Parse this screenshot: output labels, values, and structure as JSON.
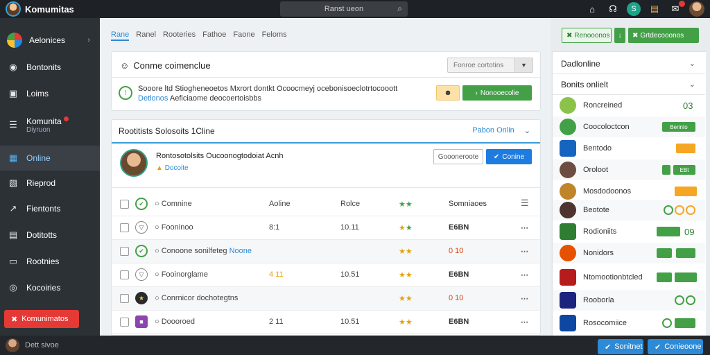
{
  "app": {
    "title": "Komumitas"
  },
  "search": {
    "text": "Ranst ueon"
  },
  "sidebar": {
    "items": [
      {
        "label": "Aelonices",
        "icon": "logo-icon"
      },
      {
        "label": "Bontonits",
        "icon": "info-icon"
      },
      {
        "label": "Loims",
        "icon": "briefcase-icon"
      },
      {
        "label": "Komunita",
        "sub": "Diyruon",
        "icon": "list-icon"
      },
      {
        "label": "Online",
        "icon": "building-icon"
      },
      {
        "label": "Rieprod",
        "icon": "image-icon"
      },
      {
        "label": "Fientonts",
        "icon": "share-icon"
      },
      {
        "label": "Dotitotts",
        "icon": "document-icon"
      },
      {
        "label": "Rootnies",
        "icon": "card-icon"
      },
      {
        "label": "Kocoiries",
        "icon": "globe-icon"
      }
    ],
    "cta": "Komunimatos"
  },
  "bottom": {
    "user": "Dett sivoe",
    "btn1": "Sonitnet",
    "btn2": "Conieoone"
  },
  "tabs": [
    "Rane",
    "Ranel",
    "Rooteries",
    "Fathoe",
    "Faone",
    "Feloms"
  ],
  "top_actions": {
    "outline": "Renooonos",
    "solid": "Grtdecooonos"
  },
  "card1": {
    "title": "Conme coimenclue",
    "select": "Fonroe cortotins",
    "text_a": "Sooore ltd Stiogheneoetos Mxrort dontkt Ocoocmeyj ocebonisoeclotrtocooott",
    "text_link": "Detlonos",
    "text_b": "Aeficiaome deocoertoisbbs",
    "green_btn": "Nonooecolie"
  },
  "card2": {
    "title": "Rootitists  Solosoits 1Cline",
    "right": "Pabon Onlin",
    "profile_name": "Rontosotolsits  Oucoonogtodoiat Acnh",
    "profile_sub": "Docoite",
    "btn_outline": "Goooneroote",
    "btn_blue": "Conine",
    "header_row": {
      "name": "Comnine",
      "c2": "Aoline",
      "c3": "Rolce",
      "c5": "Somniaoes"
    },
    "rows": [
      {
        "name": "Fooninoo",
        "c2": "8:1",
        "c3": "10.11",
        "val": "E6BN"
      },
      {
        "name": "Conoone sonilfeteg",
        "link": "Noone",
        "c2": "",
        "c3": "",
        "val": "0 10"
      },
      {
        "name": "Fooinorglame",
        "c2": "4 11",
        "c3": "10.51",
        "val": "E6BN"
      },
      {
        "name": "Conrnicor dochotegtns",
        "c2": "",
        "c3": "",
        "val": "0 10"
      },
      {
        "name": "Doooroed",
        "c2": "2 11",
        "c3": "10.51",
        "val": "E6BN"
      }
    ]
  },
  "rpanel": {
    "head1": "Dadlonline",
    "head2": "Bonits onlielt",
    "rows": [
      {
        "name": "Roncreined",
        "num": "03"
      },
      {
        "name": "Coocoloctcon",
        "badge": "Berinto"
      },
      {
        "name": "Bentodo"
      },
      {
        "name": "Oroloot",
        "num": "",
        "badge": "EBt"
      },
      {
        "name": "Mosdodoonos"
      },
      {
        "name": "Beotote"
      },
      {
        "name": "Rodioniits",
        "num": "09"
      },
      {
        "name": "Nonidors"
      },
      {
        "name": "Ntomootionbtcled"
      },
      {
        "name": "Rooborla"
      },
      {
        "name": "Rosocomiice"
      }
    ]
  },
  "colors": {
    "accent": "#2a8bd8",
    "green": "#43a047",
    "red": "#e53935",
    "sidebar": "#2c3136"
  }
}
